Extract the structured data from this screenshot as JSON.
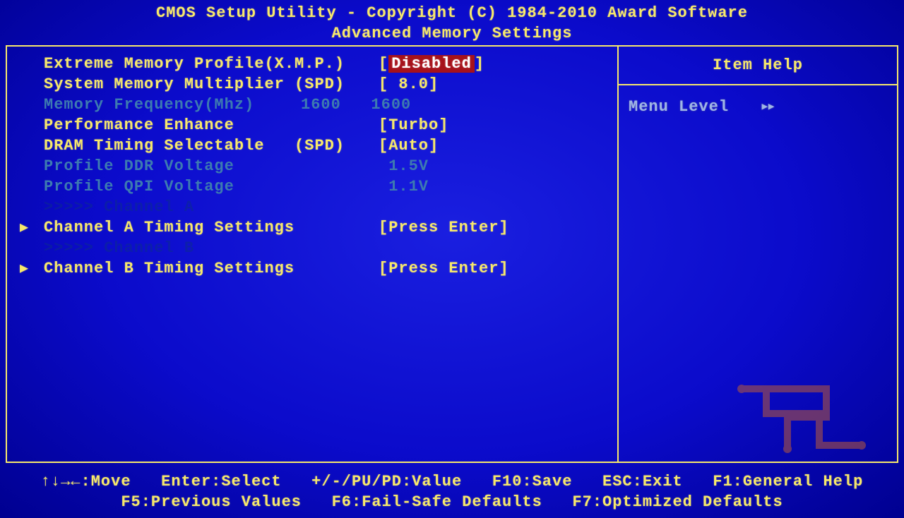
{
  "title_line1": "CMOS Setup Utility - Copyright (C) 1984-2010 Award Software",
  "title_line2": "Advanced Memory Settings",
  "rows": [
    {
      "kind": "option",
      "enabled": true,
      "highlight": true,
      "arrow": false,
      "label": "Extreme Memory Profile(X.M.P.)",
      "value": "Disabled",
      "col": ""
    },
    {
      "kind": "option",
      "enabled": true,
      "highlight": false,
      "arrow": false,
      "label": "System Memory Multiplier (SPD)",
      "value": " 8.0",
      "col": ""
    },
    {
      "kind": "readonly",
      "enabled": false,
      "arrow": false,
      "label": "Memory Frequency(Mhz)",
      "value": "1600   1600",
      "col": ""
    },
    {
      "kind": "option",
      "enabled": true,
      "highlight": false,
      "arrow": false,
      "label": "Performance Enhance",
      "value": "Turbo",
      "col": ""
    },
    {
      "kind": "option",
      "enabled": true,
      "highlight": false,
      "arrow": false,
      "label": "DRAM Timing Selectable   (SPD)",
      "value": "Auto",
      "col": ""
    },
    {
      "kind": "readonly",
      "enabled": false,
      "arrow": false,
      "label": "Profile DDR Voltage",
      "value": " 1.5V",
      "col": ""
    },
    {
      "kind": "readonly",
      "enabled": false,
      "arrow": false,
      "label": "Profile QPI Voltage",
      "value": " 1.1V",
      "col": ""
    },
    {
      "kind": "divider",
      "label": ">>>>> Channel A"
    },
    {
      "kind": "submenu",
      "enabled": true,
      "arrow": true,
      "label": "Channel A Timing Settings",
      "value": "Press Enter"
    },
    {
      "kind": "divider",
      "label": ">>>>> Channel B"
    },
    {
      "kind": "submenu",
      "enabled": true,
      "arrow": true,
      "label": "Channel B Timing Settings",
      "value": "Press Enter"
    }
  ],
  "help": {
    "title": "Item Help",
    "menu_level_label": "Menu Level",
    "menu_level_arrows": "▸▸"
  },
  "keys_line1": "↑↓→←:Move   Enter:Select   +/-/PU/PD:Value   F10:Save   ESC:Exit   F1:General Help",
  "keys_line2": "F5:Previous Values   F6:Fail-Safe Defaults   F7:Optimized Defaults"
}
